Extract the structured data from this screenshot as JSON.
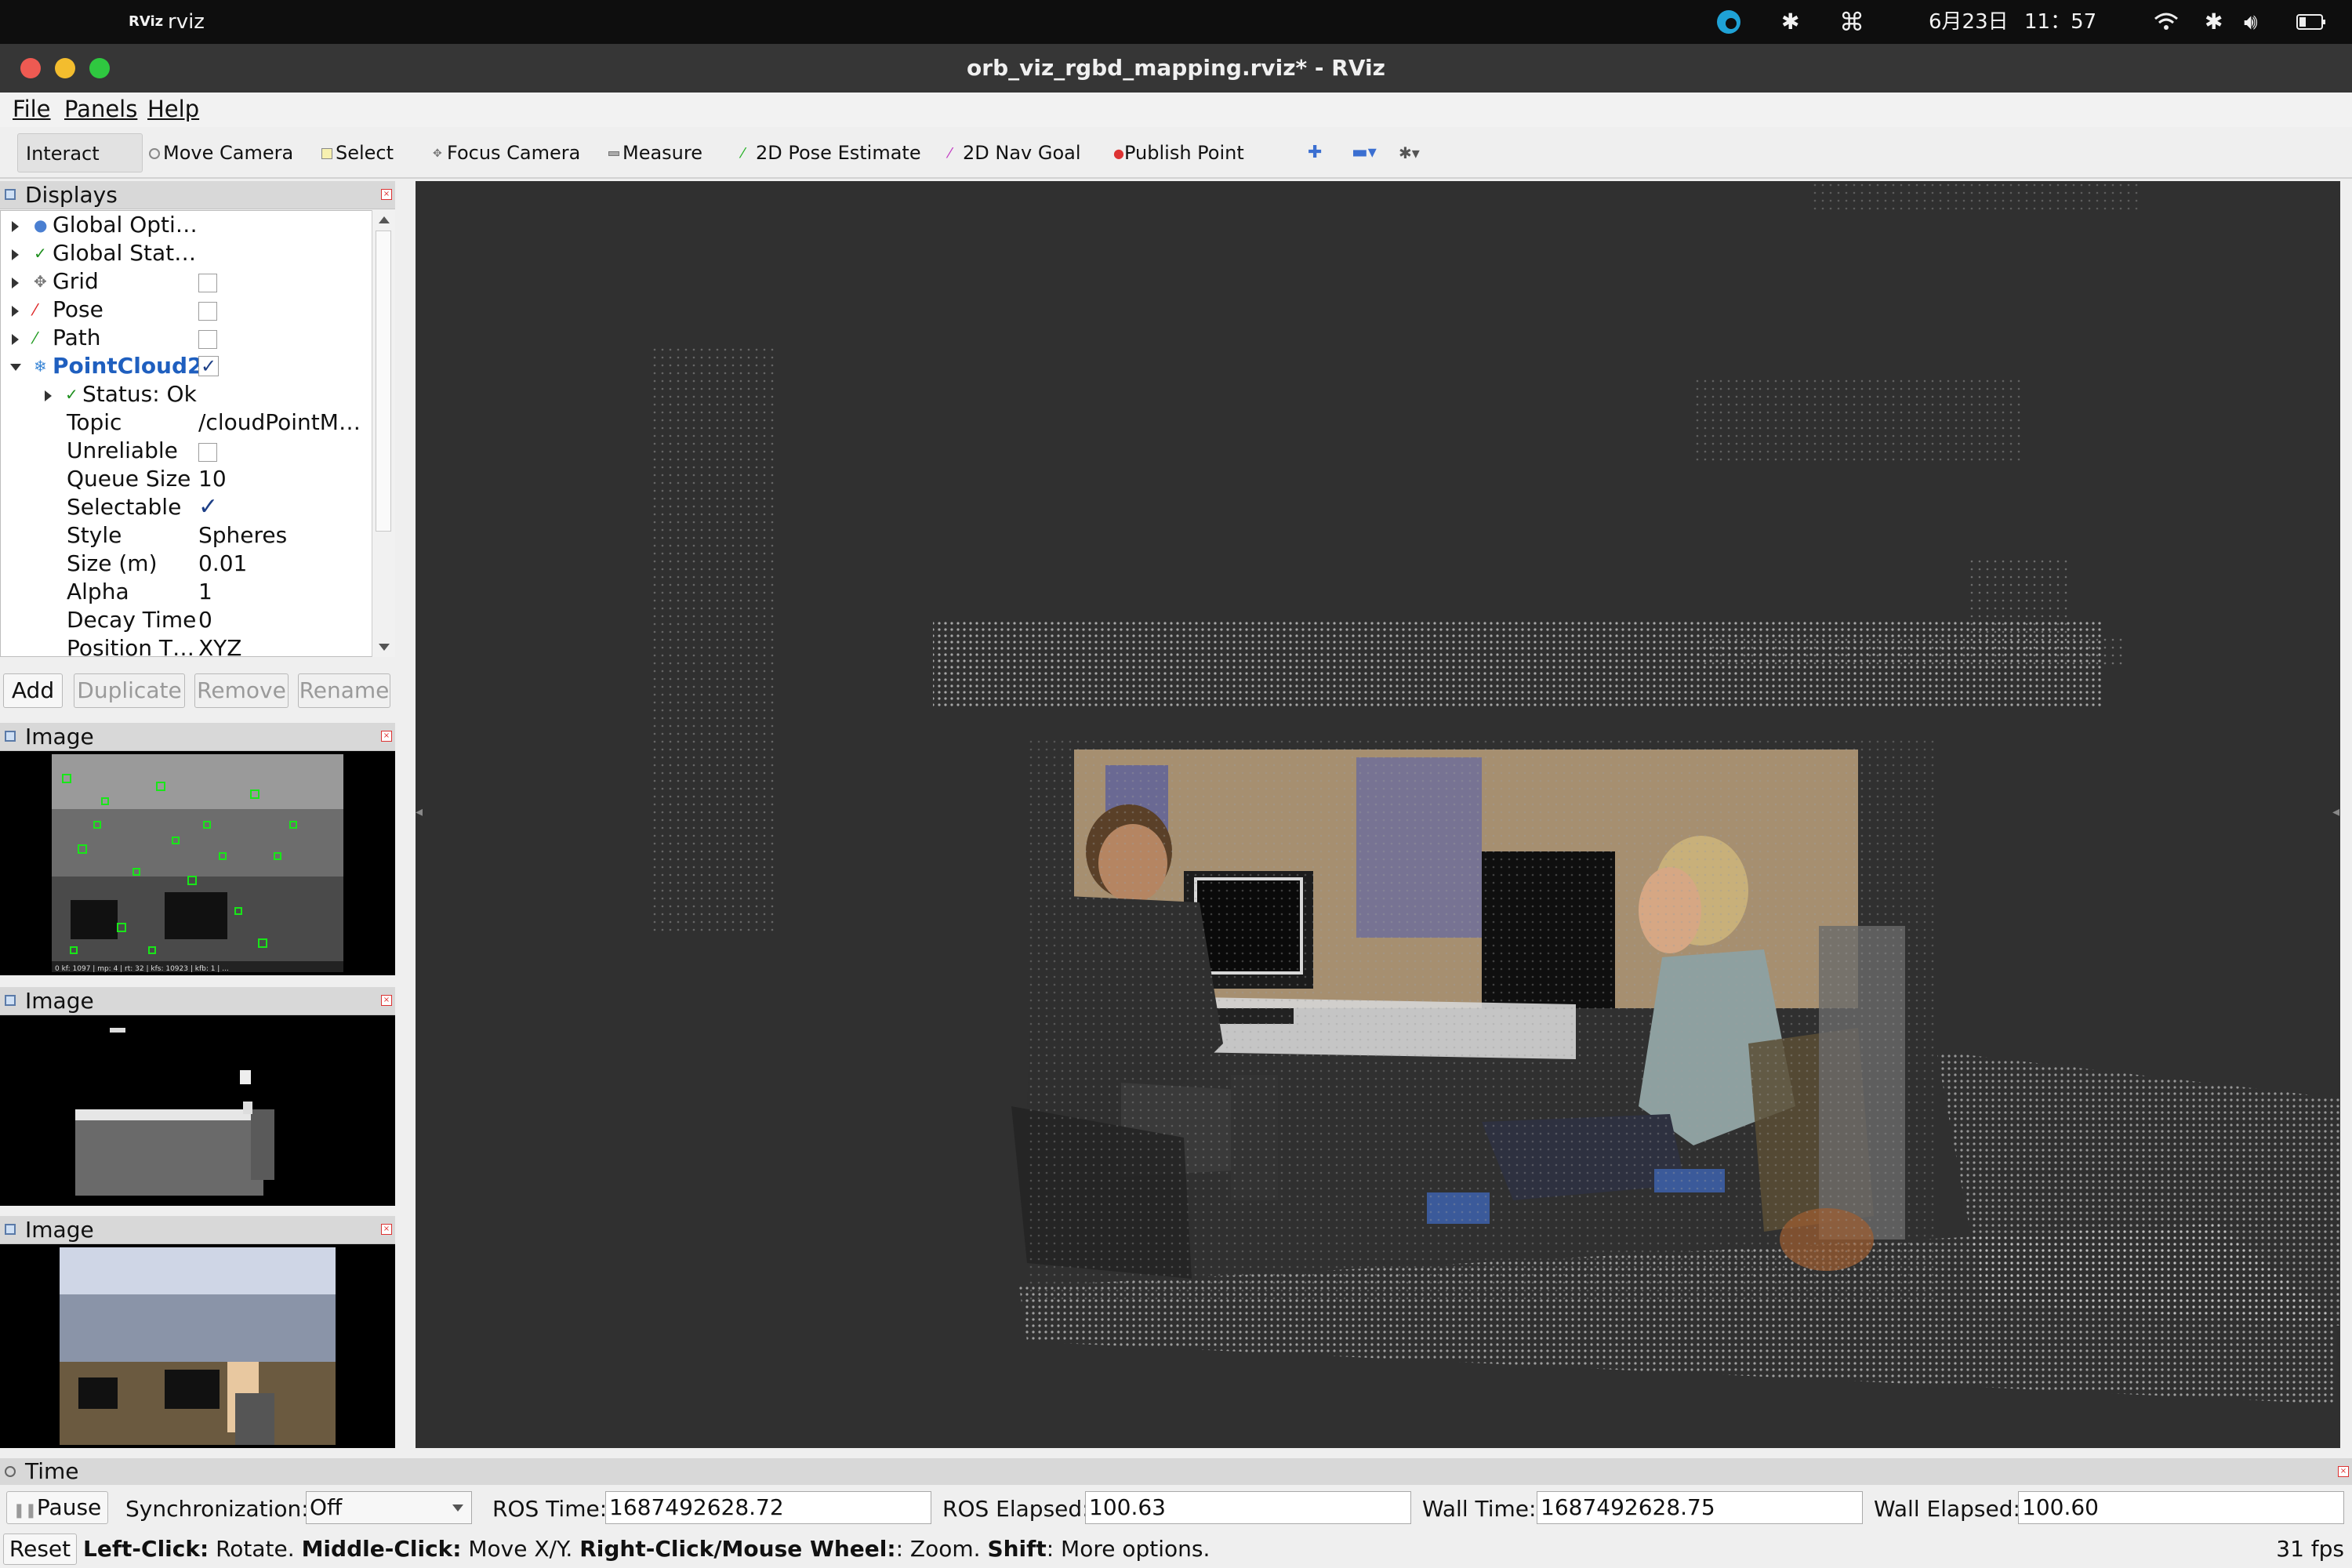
{
  "macbar": {
    "app_name": "rviz",
    "app_badge": "RViz",
    "date": "6月23日",
    "time": "11：57"
  },
  "window": {
    "title": "orb_viz_rgbd_mapping.rviz* - RViz"
  },
  "menu": [
    "File",
    "Panels",
    "Help"
  ],
  "toolbar": [
    "Interact",
    "Move Camera",
    "Select",
    "Focus Camera",
    "Measure",
    "2D Pose Estimate",
    "2D Nav Goal",
    "Publish Point"
  ],
  "displays": {
    "title": "Displays",
    "items": [
      {
        "label": "Global Opti…",
        "value": ""
      },
      {
        "label": "Global Stat…",
        "value": ""
      },
      {
        "label": "Grid",
        "checked": false
      },
      {
        "label": "Pose",
        "checked": false
      },
      {
        "label": "Path",
        "checked": false
      },
      {
        "label": "PointCloud2",
        "checked": true
      }
    ],
    "props": [
      {
        "label": "Status: Ok",
        "value": ""
      },
      {
        "label": "Topic",
        "value": "/cloudPointM…"
      },
      {
        "label": "Unreliable",
        "value": ""
      },
      {
        "label": "Queue Size",
        "value": "10"
      },
      {
        "label": "Selectable",
        "value": "✓"
      },
      {
        "label": "Style",
        "value": "Spheres"
      },
      {
        "label": "Size (m)",
        "value": "0.01"
      },
      {
        "label": "Alpha",
        "value": "1"
      },
      {
        "label": "Decay Time",
        "value": "0"
      },
      {
        "label": "Position T…",
        "value": "XYZ"
      }
    ],
    "buttons": {
      "add": "Add",
      "duplicate": "Duplicate",
      "remove": "Remove",
      "rename": "Rename"
    }
  },
  "image_panels": [
    "Image",
    "Image",
    "Image"
  ],
  "image_overlay": "0 kf: 1097 | mp: 4 | rt: 32 | kfs: 10923 | kfb: 1 | ...",
  "time": {
    "title": "Time",
    "pause": "Pause",
    "sync_label": "Synchronization:",
    "sync_value": "Off",
    "ros_time_label": "ROS Time:",
    "ros_time": "1687492628.72",
    "ros_elapsed_label": "ROS Elapsed:",
    "ros_elapsed": "100.63",
    "wall_time_label": "Wall Time:",
    "wall_time": "1687492628.75",
    "wall_elapsed_label": "Wall Elapsed:",
    "wall_elapsed": "100.60"
  },
  "status": {
    "reset": "Reset",
    "b1": "Left-Click:",
    "t1": " Rotate. ",
    "b2": "Middle-Click:",
    "t2": " Move X/Y. ",
    "b3": "Right-Click/Mouse Wheel:",
    "t3": ": Zoom. ",
    "b4": "Shift",
    "t4": ": More options.",
    "fps": "31 fps"
  },
  "colors": {
    "viewport_bg": "#303030",
    "selected_display": "#1f5fbf",
    "feature_points": "#19e619"
  }
}
